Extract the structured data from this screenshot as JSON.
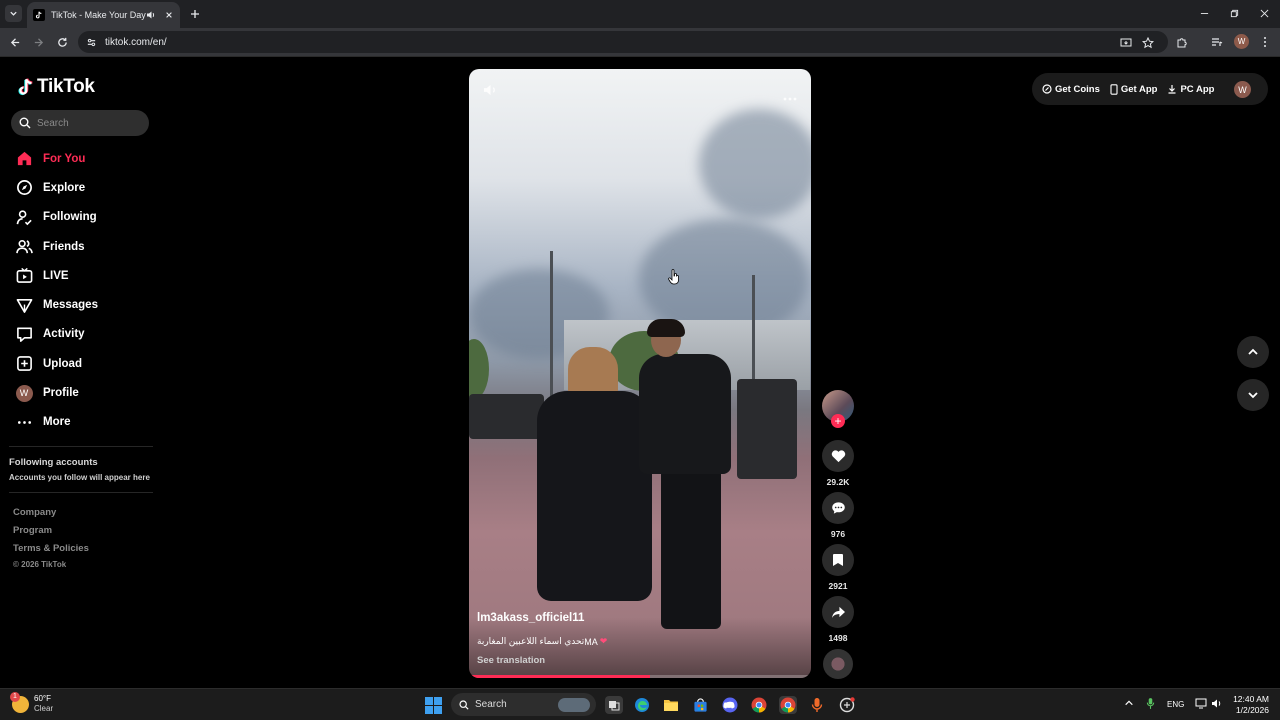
{
  "browser": {
    "tab_title": "TikTok - Make Your Day",
    "url": "tiktok.com/en/",
    "profile_initial": "W"
  },
  "sidebar": {
    "logo": "TikTok",
    "search_placeholder": "Search",
    "items": [
      {
        "label": "For You",
        "icon": "home-icon",
        "active": true
      },
      {
        "label": "Explore",
        "icon": "compass-icon"
      },
      {
        "label": "Following",
        "icon": "following-icon"
      },
      {
        "label": "Friends",
        "icon": "friends-icon"
      },
      {
        "label": "LIVE",
        "icon": "live-icon"
      },
      {
        "label": "Messages",
        "icon": "messages-icon"
      },
      {
        "label": "Activity",
        "icon": "activity-icon"
      },
      {
        "label": "Upload",
        "icon": "upload-icon"
      },
      {
        "label": "Profile",
        "icon": "avatar"
      },
      {
        "label": "More",
        "icon": "more-icon"
      }
    ],
    "profile_initial": "W",
    "following_title": "Following accounts",
    "following_sub": "Accounts you follow will appear here",
    "footer": [
      "Company",
      "Program",
      "Terms & Policies"
    ],
    "copyright": "© 2026 TikTok"
  },
  "video": {
    "username": "lm3akass_officiel11",
    "caption": "تحدي اسماء اللاعبين المغاربة",
    "caption_tail": "MA",
    "see_translation": "See translation",
    "progress": 0.53
  },
  "actions": {
    "likes": "29.2K",
    "comments": "976",
    "saves": "2921",
    "shares": "1498"
  },
  "header": {
    "get_coins": "Get Coins",
    "get_app": "Get App",
    "pc_app": "PC App",
    "profile_initial": "W"
  },
  "taskbar": {
    "weather_temp": "60°F",
    "weather_cond": "Clear",
    "weather_badge": "1",
    "search_label": "Search",
    "lang": "ENG",
    "time": "12:40 AM",
    "date": "1/2/2026"
  },
  "colors": {
    "accent": "#fe2c55",
    "page_bg": "#000000",
    "browser_bar": "#35363a"
  }
}
